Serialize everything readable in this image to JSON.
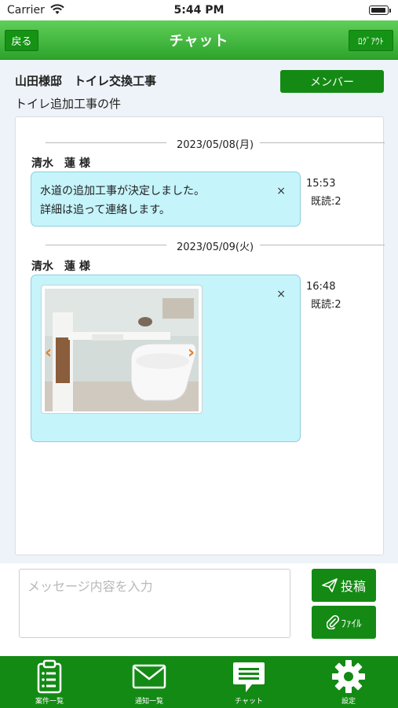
{
  "status_bar": {
    "carrier": "Carrier",
    "time": "5:44 PM"
  },
  "nav": {
    "back_label": "戻る",
    "title": "チャット",
    "logout_label": "ﾛｸﾞｱｳﾄ"
  },
  "header": {
    "project_title": "山田様邸　トイレ交換工事",
    "member_button": "メンバー",
    "subject": "トイレ追加工事の件"
  },
  "messages": [
    {
      "date": "2023/05/08(月)",
      "sender": "清水　蓮 様",
      "text": "水道の追加工事が決定しました。\n詳細は追って連絡します。",
      "close": "×",
      "time": "15:53",
      "read": "既読:2"
    },
    {
      "date": "2023/05/09(火)",
      "sender": "清水　蓮 様",
      "attachment_icon": "toilet-photo",
      "close": "×",
      "time": "16:48",
      "read": "既読:2"
    }
  ],
  "composer": {
    "placeholder": "メッセージ内容を入力",
    "value": "",
    "post_label": "投稿",
    "file_label": "ﾌｧｲﾙ"
  },
  "tabs": [
    {
      "label": "案件一覧",
      "icon": "clipboard-icon"
    },
    {
      "label": "通知一覧",
      "icon": "envelope-icon"
    },
    {
      "label": "チャット",
      "icon": "chat-icon",
      "active": true
    },
    {
      "label": "設定",
      "icon": "gear-icon"
    }
  ],
  "colors": {
    "nav_green": "#2ea42c",
    "button_green": "#148a14",
    "bubble": "#c5f4fb",
    "tab_bar": "#138a14"
  }
}
